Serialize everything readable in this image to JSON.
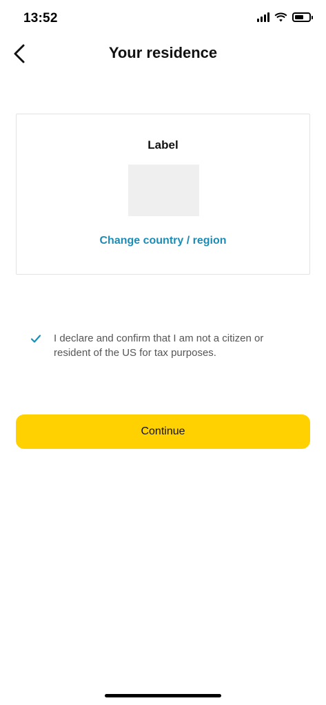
{
  "status_bar": {
    "time": "13:52",
    "icons": [
      "signal-icon",
      "wifi-icon",
      "battery-icon"
    ]
  },
  "header": {
    "back_icon": "chevron-left-icon",
    "title": "Your residence"
  },
  "country_card": {
    "label": "Label",
    "change_link": "Change country / region"
  },
  "declaration": {
    "checked": true,
    "check_icon": "checkmark-icon",
    "text": "I declare and confirm that I am not a citizen or resident of the US for tax purposes."
  },
  "continue_button": {
    "label": "Continue"
  },
  "colors": {
    "accent_yellow": "#ffd100",
    "link_blue": "#1b8cb6",
    "check_blue": "#1b8cb6",
    "placeholder_gray": "#efefef",
    "border_gray": "#e2e2e2"
  }
}
